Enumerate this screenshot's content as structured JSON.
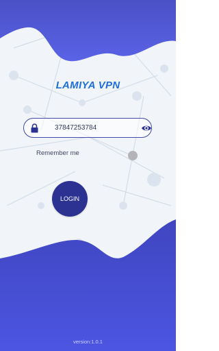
{
  "app": {
    "title": "LAMIYA VPN",
    "version": "version:1.0.1"
  },
  "login_form": {
    "input_value": "37847253784",
    "remember_label": "Remember me",
    "remember_enabled": false,
    "login_label": "LOGIN"
  },
  "icons": {
    "lock": "lock-icon",
    "visibility": "eye-icon"
  },
  "colors": {
    "accent_blue": "#1c6fd8",
    "wave_blue": "#4b52d8",
    "button_navy": "#2b3292",
    "toggle_off": "#b3b3b8"
  }
}
